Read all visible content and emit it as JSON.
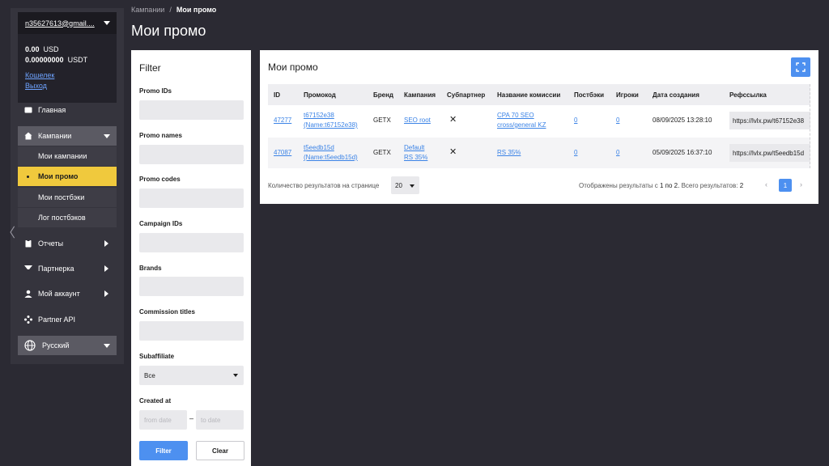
{
  "sidebar": {
    "email": "n35627613@gmail....",
    "balance_usd": "0.00",
    "currency_usd": "USD",
    "balance_usdt": "0.00000000",
    "currency_usdt": "USDT",
    "wallet_link": "Кошелек",
    "logout_link": "Выход",
    "items": {
      "home": "Главная",
      "campaigns": "Кампании",
      "my_campaigns": "Мои кампании",
      "my_promo": "Мои промо",
      "my_postbacks": "Мои постбэки",
      "postback_log": "Лог постбэков",
      "reports": "Отчеты",
      "partners": "Партнерка",
      "my_account": "Мой аккаунт",
      "partner_api": "Partner API"
    },
    "language": "Русский"
  },
  "breadcrumb": {
    "parent": "Кампании",
    "separator": "/",
    "current": "Мои промо"
  },
  "page_title": "Мои промо",
  "filter": {
    "title": "Filter",
    "promo_ids_label": "Promo IDs",
    "promo_names_label": "Promo names",
    "promo_codes_label": "Promo codes",
    "campaign_ids_label": "Campaign IDs",
    "brands_label": "Brands",
    "commission_titles_label": "Commission titles",
    "subaffiliate_label": "Subaffiliate",
    "subaffiliate_value": "Все",
    "created_at_label": "Created at",
    "date_from_placeholder": "from date",
    "date_separator": "–",
    "date_to_placeholder": "to date",
    "filter_button": "Filter",
    "clear_button": "Clear"
  },
  "main": {
    "title": "Мои промо",
    "columns": [
      "ID",
      "Промокод",
      "Бренд",
      "Кампания",
      "Субпартнер",
      "Название комиссии",
      "Постбэки",
      "Игроки",
      "Дата создания",
      "Рефссылка"
    ],
    "rows": [
      {
        "id": "47277",
        "promo_line1": "t67152e38",
        "promo_line2": "(Name:t67152e38)",
        "brand": "GETX",
        "campaign_line1": "SEO root",
        "campaign_line2": "",
        "subpartner": "✕",
        "commission_line1": "CPA 70 SEO",
        "commission_line2": "cross/general KZ",
        "postbacks": "0",
        "players": "0",
        "created": "08/09/2025 13:28:10",
        "reflink": "https://lvlx.pw/t67152e38"
      },
      {
        "id": "47087",
        "promo_line1": "t5eedb15d",
        "promo_line2": "(Name:t5eedb15d)",
        "brand": "GETX",
        "campaign_line1": "Default",
        "campaign_line2": "RS 35%",
        "subpartner": "✕",
        "commission_line1": "RS 35%",
        "commission_line2": "",
        "postbacks": "0",
        "players": "0",
        "created": "05/09/2025 16:37:10",
        "reflink": "https://lvlx.pw/t5eedb15d"
      }
    ],
    "per_page_label": "Количество результатов на странице",
    "per_page_value": "20",
    "results_prefix": "Отображены результаты с",
    "results_range": "1 по 2.",
    "results_total_label": "Всего результатов:",
    "results_total": "2",
    "pagination_prev": "‹",
    "pagination_current": "1",
    "pagination_next": "›"
  },
  "colors": {
    "accent": "#4d90f0",
    "active_nav": "#f0c93d",
    "background": "#2b2a33"
  }
}
